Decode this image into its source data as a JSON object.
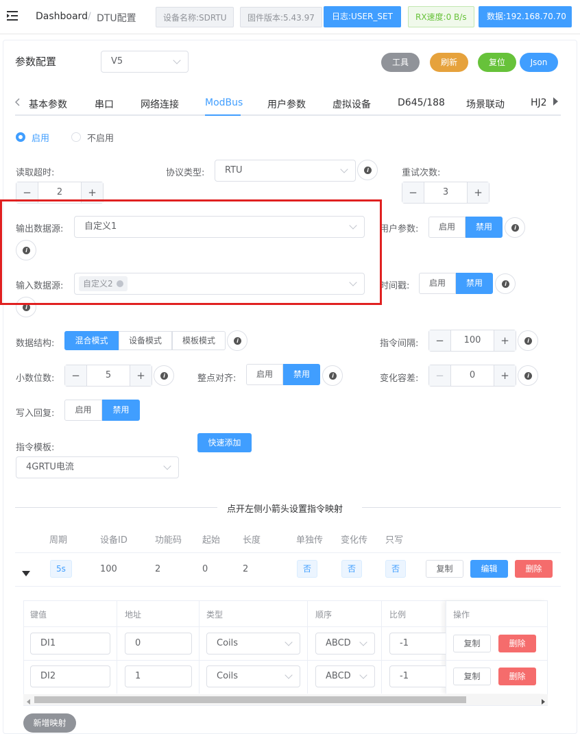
{
  "breadcrumb": {
    "home": "Dashboard",
    "sep": "/",
    "current": "DTU配置"
  },
  "header": {
    "device_name": "设备名称:SDRTU",
    "firmware": "固件版本:5.43.97",
    "log_button": "日志:USER_SET",
    "rx_speed": "RX速度:0 B/s",
    "data_button": "数据:192.168.70.70"
  },
  "card": {
    "title": "参数配置",
    "version": "V5",
    "buttons": {
      "tools": "工具",
      "refresh": "刷新",
      "reset": "复位",
      "json": "Json"
    }
  },
  "tabs": [
    "基本参数",
    "串口",
    "网络连接",
    "ModBus",
    "用户参数",
    "虚拟设备",
    "D645/188",
    "场景联动",
    "HJ2"
  ],
  "active_tab": "ModBus",
  "enable": {
    "on": "启用",
    "off": "不启用",
    "selected": "启用"
  },
  "read_timeout": {
    "label": "读取超时:",
    "value": "2"
  },
  "protocol": {
    "label": "协议类型:",
    "value": "RTU"
  },
  "retries": {
    "label": "重试次数:",
    "value": "3"
  },
  "output_source": {
    "label": "输出数据源:",
    "value": "自定义1"
  },
  "input_source": {
    "label": "输入数据源:",
    "tag": "自定义2"
  },
  "user_param": {
    "label": "用户参数:",
    "on": "启用",
    "off": "禁用",
    "selected": "禁用"
  },
  "timestamp": {
    "label": "时间戳:",
    "on": "启用",
    "off": "禁用",
    "selected": "禁用"
  },
  "data_structure": {
    "label": "数据结构:",
    "options": [
      "混合模式",
      "设备模式",
      "模板模式"
    ],
    "selected": "混合模式"
  },
  "cmd_interval": {
    "label": "指令间隔:",
    "value": "100"
  },
  "decimals": {
    "label": "小数位数:",
    "value": "5"
  },
  "hour_align": {
    "label": "整点对齐:",
    "on": "启用",
    "off": "禁用",
    "selected": "禁用"
  },
  "change_tolerance": {
    "label": "变化容差:",
    "value": "0"
  },
  "write_reply": {
    "label": "写入回复:",
    "on": "启用",
    "off": "禁用",
    "selected": "禁用"
  },
  "cmd_template": {
    "label": "指令模板:",
    "value": "4GRTU电流",
    "quick_add": "快速添加"
  },
  "divider_text": "点开左侧小箭头设置指令映射",
  "table": {
    "headers": [
      "周期",
      "设备ID",
      "功能码",
      "起始",
      "长度",
      "单独传",
      "变化传",
      "只写"
    ],
    "row": {
      "period": "5s",
      "device_id": "100",
      "func_code": "2",
      "start": "0",
      "length": "2",
      "single": "否",
      "change": "否",
      "write_only": "否",
      "copy": "复制",
      "edit": "编辑",
      "delete": "删除"
    }
  },
  "mapping": {
    "headers": [
      "键值",
      "地址",
      "类型",
      "顺序",
      "比例",
      "操作"
    ],
    "rows": [
      {
        "key": "DI1",
        "addr": "0",
        "type": "Coils",
        "order": "ABCD",
        "ratio": "-1",
        "copy": "复制",
        "delete": "删除"
      },
      {
        "key": "DI2",
        "addr": "1",
        "type": "Coils",
        "order": "ABCD",
        "ratio": "-1",
        "copy": "复制",
        "delete": "删除"
      }
    ],
    "add_button": "新增映射"
  },
  "colors": {
    "primary": "#409eff",
    "danger": "#f56c6c",
    "success": "#67c23a",
    "warning": "#e6a23c",
    "info": "#909399",
    "highlight": "#e02020"
  }
}
